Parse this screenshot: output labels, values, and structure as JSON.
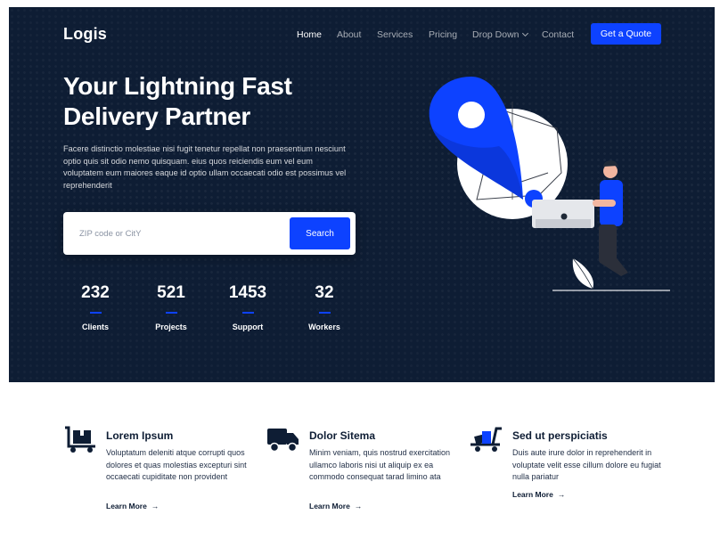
{
  "header": {
    "logo": "Logis",
    "nav": [
      "Home",
      "About",
      "Services",
      "Pricing",
      "Drop Down",
      "Contact"
    ],
    "cta": "Get a Quote"
  },
  "hero": {
    "title": "Your Lightning Fast Delivery Partner",
    "description": "Facere distinctio molestiae nisi fugit tenetur repellat non praesentium nesciunt optio quis sit odio nemo quisquam. eius quos reiciendis eum vel eum voluptatem eum maiores eaque id optio ullam occaecati odio est possimus vel reprehenderit",
    "search": {
      "placeholder": "ZIP code or CitY",
      "button": "Search"
    },
    "stats": [
      {
        "value": "232",
        "label": "Clients"
      },
      {
        "value": "521",
        "label": "Projects"
      },
      {
        "value": "1453",
        "label": "Support"
      },
      {
        "value": "32",
        "label": "Workers"
      }
    ]
  },
  "features": [
    {
      "icon": "hand-truck-icon",
      "title": "Lorem Ipsum",
      "text": "Voluptatum deleniti atque corrupti quos dolores et quas molestias excepturi sint occaecati cupiditate non provident",
      "link": "Learn More"
    },
    {
      "icon": "truck-icon",
      "title": "Dolor Sitema",
      "text": "Minim veniam, quis nostrud exercitation ullamco laboris nisi ut aliquip ex ea commodo consequat tarad limino ata",
      "link": "Learn More"
    },
    {
      "icon": "dolly-icon",
      "title": "Sed ut perspiciatis",
      "text": "Duis aute irure dolor in reprehenderit in voluptate velit esse cillum dolore eu fugiat nulla pariatur",
      "link": "Learn More"
    }
  ],
  "colors": {
    "primary": "#0d42ff",
    "dark": "#0e1d34"
  }
}
